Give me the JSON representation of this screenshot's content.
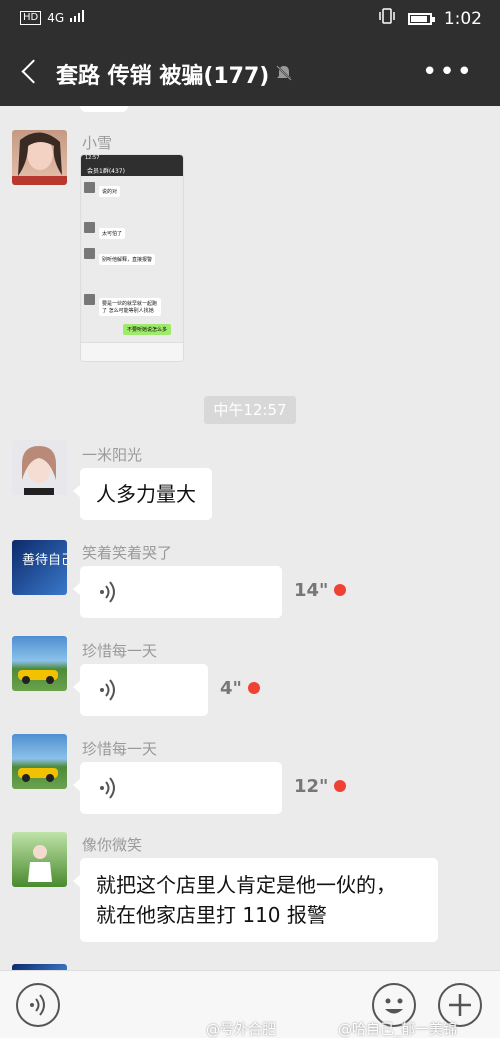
{
  "statusbar": {
    "left": "HD",
    "signal": "4G",
    "time": "1:02"
  },
  "header": {
    "title": "套路 传销 被骗(177)",
    "back": "back",
    "more": "•••"
  },
  "messages": [
    {
      "sender": "小雪",
      "type": "image"
    },
    {
      "time_divider": "中午12:57"
    },
    {
      "sender": "一米阳光",
      "text": "人多力量大"
    },
    {
      "sender": "笑着笑着哭了",
      "type": "voice",
      "duration": "14\""
    },
    {
      "sender": "珍惜每一天",
      "type": "voice",
      "duration": "4\""
    },
    {
      "sender": "珍惜每一天",
      "type": "voice",
      "duration": "12\""
    },
    {
      "sender": "像你微笑",
      "text_line1": "就把这个店里人肯定是他一伙的，",
      "text_line2": "就在他家店里打 110 报警"
    }
  ],
  "screenshot_thumb": {
    "time": "12:57",
    "title": "会员1群(437)",
    "lines": [
      "说的对",
      "太可怕了",
      "别听他解释，直接报警",
      "要是一伙的就早就一起跑了 怎么可能等别人找她",
      "不要听她说怎么多"
    ]
  },
  "avatar_text": {
    "xiaozhao": "善待自己"
  },
  "watermarks": [
    "@号外合肥",
    "@哈自己_郁一美锦"
  ],
  "colors": {
    "header_bg": "#2f2f2f",
    "chat_bg": "#ebebeb",
    "unread_dot": "#f04135",
    "sent_green": "#9eea6a"
  },
  "icons": {
    "mute": "mute-bell-icon",
    "voice": "voice-wave-icon",
    "emoji": "emoji-icon",
    "plus": "plus-icon"
  }
}
